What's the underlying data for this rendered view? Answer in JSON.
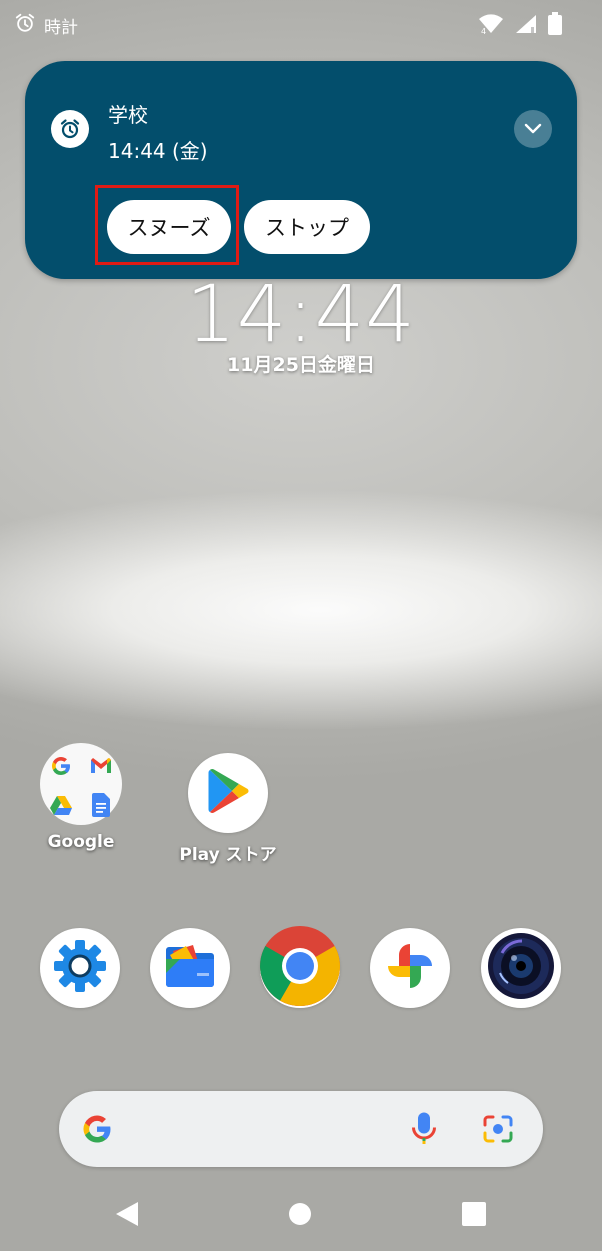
{
  "status_bar": {
    "app_name": "時計",
    "icons": [
      "alarm-icon",
      "wifi-icon",
      "signal-icon",
      "battery-icon"
    ]
  },
  "notification": {
    "title": "学校",
    "time": "14:44 (金)",
    "actions": {
      "snooze": "スヌーズ",
      "stop": "ストップ"
    },
    "bg_color": "#034e6c",
    "highlight_color": "#e01b14"
  },
  "clock": {
    "time": "14:44",
    "date": "11月25日金曜日"
  },
  "home_apps": {
    "google_folder_label": "Google",
    "play_store_label": "Play ストア"
  },
  "dock": [
    "settings-icon",
    "files-icon",
    "chrome-icon",
    "photos-icon",
    "camera-icon"
  ],
  "search_bar": {
    "icons": [
      "google-g-icon",
      "mic-icon",
      "lens-icon"
    ]
  },
  "nav_bar": [
    "back-icon",
    "home-icon",
    "recents-icon"
  ]
}
